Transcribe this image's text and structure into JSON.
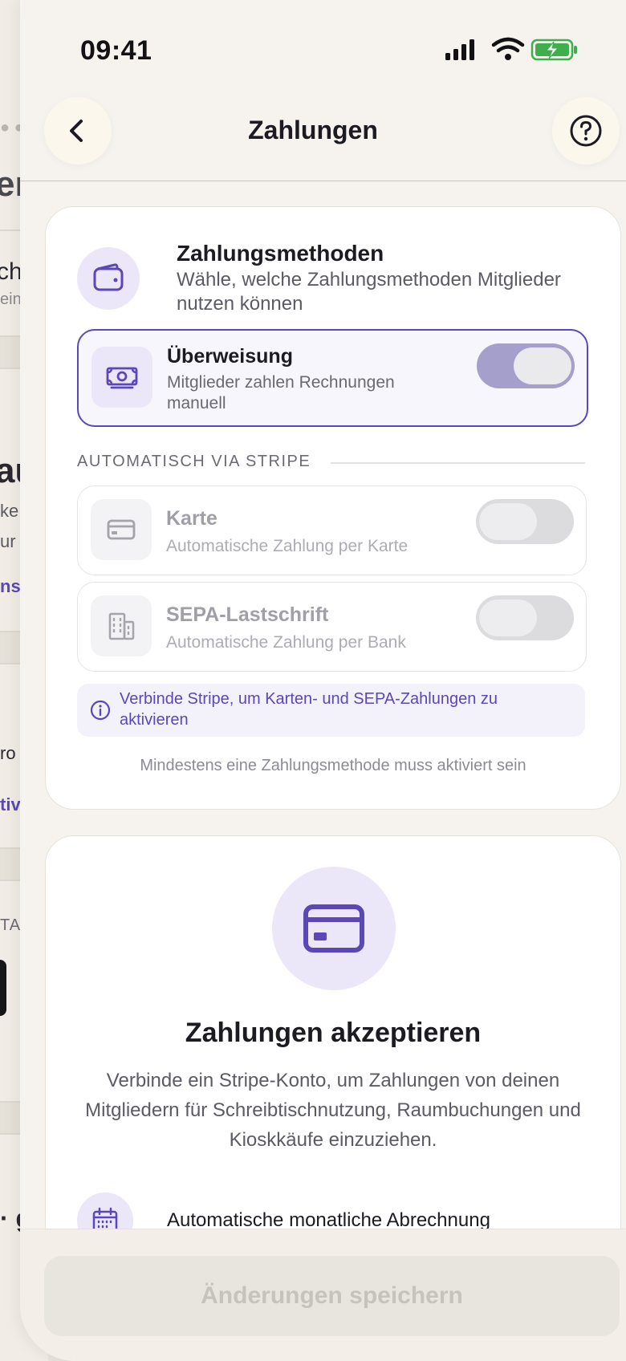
{
  "background_fragments": [
    "er",
    "ch",
    "ein",
    "au",
    "ke",
    "ur",
    "nse",
    "ro",
    "tiv",
    "TA",
    "· g"
  ],
  "status_bar": {
    "time": "09:41"
  },
  "nav": {
    "title": "Zahlungen",
    "back_icon": "chevron-left-icon",
    "help_icon": "help-circle-icon"
  },
  "payment_methods": {
    "icon": "wallet-icon",
    "title": "Zahlungsmethoden",
    "description": "Wähle, welche Zahlungsmethoden Mitglieder nutzen können",
    "bank_transfer": {
      "icon": "banknote-icon",
      "title": "Überweisung",
      "subtitle": "Mitglieder zahlen Rechnungen manuell",
      "enabled": true
    },
    "section_label": "AUTOMATISCH VIA STRIPE",
    "card": {
      "icon": "credit-card-icon",
      "title": "Karte",
      "subtitle": "Automatische Zahlung per Karte",
      "enabled": false
    },
    "sepa": {
      "icon": "building-icon",
      "title": "SEPA-Lastschrift",
      "subtitle": "Automatische Zahlung per Bank",
      "enabled": false
    },
    "info": "Verbinde Stripe, um Karten- und SEPA-Zahlungen zu aktivieren",
    "note": "Mindestens eine Zahlungsmethode muss aktiviert sein"
  },
  "accept": {
    "icon": "credit-card-icon",
    "title": "Zahlungen akzeptieren",
    "description": "Verbinde ein Stripe-Konto, um Zahlungen von deinen Mitgliedern für Schreibtischnutzung, Raumbuchungen und Kioskkäufe einzuziehen.",
    "feature_icon": "calendar-icon",
    "feature": "Automatische monatliche Abrechnung"
  },
  "footer": {
    "save_label": "Änderungen speichern"
  },
  "colors": {
    "accent": "#5a48b6",
    "accent_light": "#ebe7f8",
    "sheet_bg": "#f6f3ee"
  }
}
